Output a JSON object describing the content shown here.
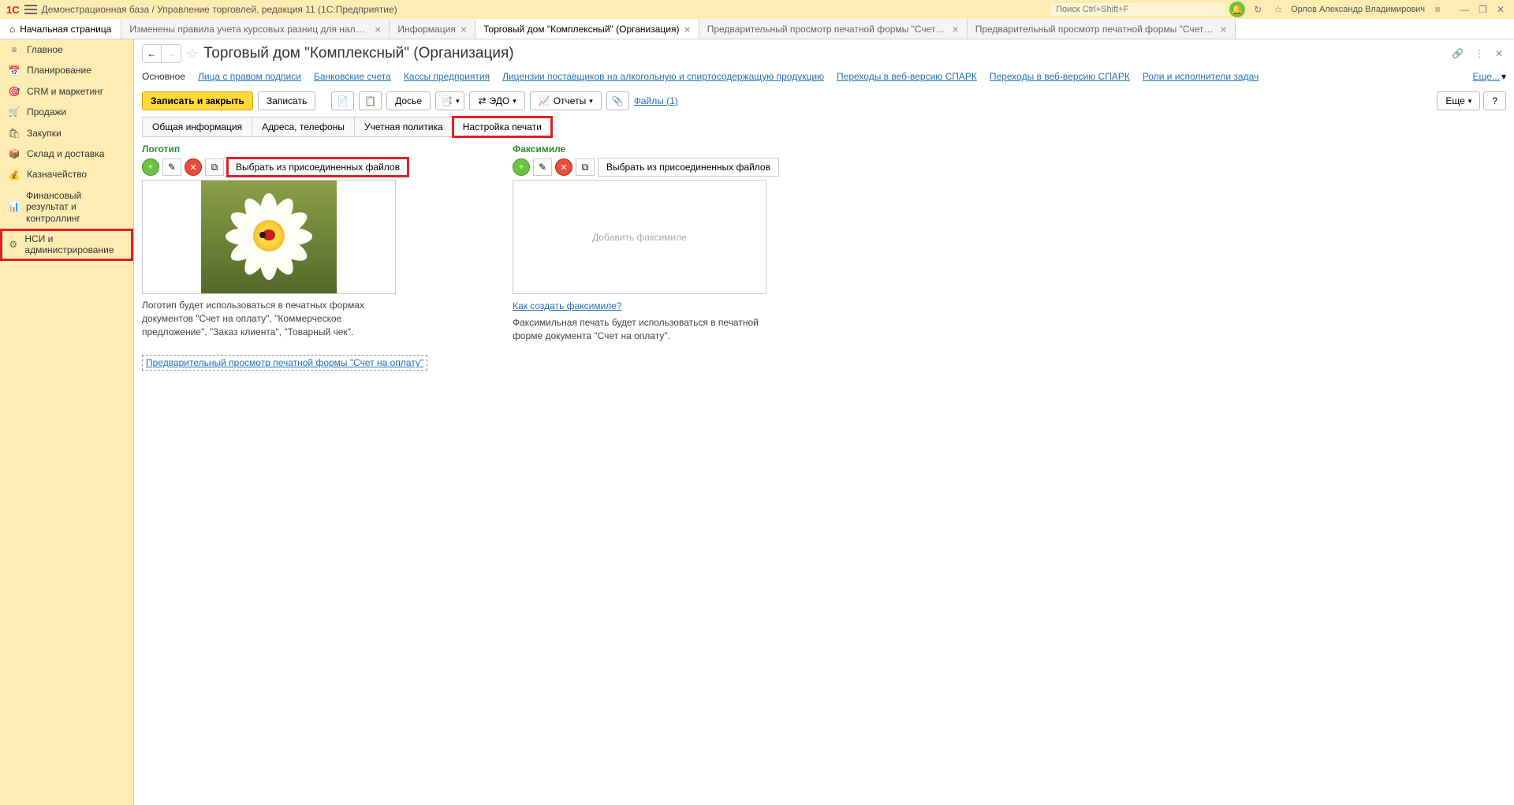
{
  "topbar": {
    "logo": "1C",
    "title": "Демонстрационная база / Управление торговлей, редакция 11  (1С:Предприятие)",
    "search_placeholder": "Поиск Ctrl+Shift+F",
    "user": "Орлов Александр Владимирович"
  },
  "tabs": {
    "home": "Начальная страница",
    "items": [
      {
        "label": "Изменены правила учета курсовых разниц для налога на прибыль",
        "active": false
      },
      {
        "label": "Информация",
        "active": false
      },
      {
        "label": "Торговый дом \"Комплексный\" (Организация)",
        "active": true
      },
      {
        "label": "Предварительный просмотр печатной формы \"Счет на оплату\".",
        "active": false
      },
      {
        "label": "Предварительный просмотр печатной формы \"Счет на оплату\".",
        "active": false
      }
    ]
  },
  "sidebar": {
    "items": [
      {
        "icon": "≡",
        "label": "Главное"
      },
      {
        "icon": "📅",
        "label": "Планирование"
      },
      {
        "icon": "🎯",
        "label": "CRM и маркетинг"
      },
      {
        "icon": "🛒",
        "label": "Продажи"
      },
      {
        "icon": "🛍",
        "label": "Закупки"
      },
      {
        "icon": "📦",
        "label": "Склад и доставка"
      },
      {
        "icon": "💰",
        "label": "Казначейство"
      },
      {
        "icon": "📊",
        "label": "Финансовый результат и контроллинг"
      },
      {
        "icon": "⚙",
        "label": "НСИ и администрирование",
        "highlighted": true
      }
    ]
  },
  "page": {
    "title": "Торговый дом \"Комплексный\" (Организация)"
  },
  "subnav": {
    "items": [
      {
        "label": "Основное",
        "active": true
      },
      {
        "label": "Лица с правом подписи"
      },
      {
        "label": "Банковские счета"
      },
      {
        "label": "Кассы предприятия"
      },
      {
        "label": "Лицензии поставщиков на алкогольную и спиртосодержащую продукцию"
      },
      {
        "label": "Переходы в веб-версию СПАРК"
      },
      {
        "label": "Переходы в веб-версию СПАРК"
      },
      {
        "label": "Роли и исполнители задач"
      }
    ],
    "more": "Еще..."
  },
  "toolbar": {
    "save_close": "Записать и закрыть",
    "save": "Записать",
    "dossier": "Досье",
    "edo": "ЭДО",
    "reports": "Отчеты",
    "files": "Файлы (1)",
    "more": "Еще",
    "help": "?"
  },
  "inner_tabs": [
    {
      "label": "Общая информация"
    },
    {
      "label": "Адреса, телефоны"
    },
    {
      "label": "Учетная политика"
    },
    {
      "label": "Настройка печати",
      "active": true,
      "highlighted": true
    }
  ],
  "logo_section": {
    "title": "Логотип",
    "select_btn": "Выбрать из присоединенных файлов",
    "select_btn_highlighted": true,
    "description": "Логотип будет использоваться в печатных формах документов \"Счет на оплату\", \"Коммерческое предложение\", \"Заказ клиента\", \"Товарный чек\".",
    "preview_link": "Предварительный просмотр печатной формы \"Счет на оплату\""
  },
  "fax_section": {
    "title": "Факсимиле",
    "select_btn": "Выбрать  из присоединенных файлов",
    "placeholder": "Добавить факсимиле",
    "how_link": "Как создать факсимиле?",
    "description": "Факсимильная печать будет использоваться в печатной форме документа \"Счет на оплату\"."
  }
}
